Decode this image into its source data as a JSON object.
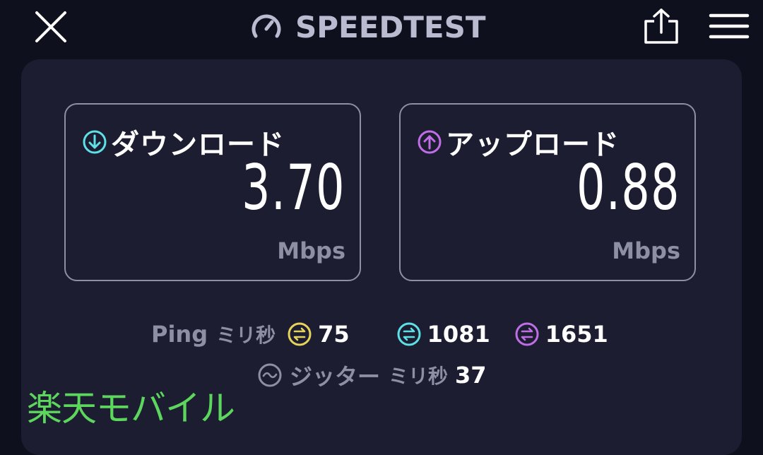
{
  "header": {
    "app_title": "SPEEDTEST",
    "close_icon": "close-icon",
    "share_icon": "share-icon",
    "menu_icon": "menu-icon"
  },
  "download": {
    "label": "ダウンロード",
    "value": "3.70",
    "unit": "Mbps",
    "icon": "download-arrow-icon",
    "accent_color": "#5de0e6"
  },
  "upload": {
    "label": "アップロード",
    "value": "0.88",
    "unit": "Mbps",
    "icon": "upload-arrow-icon",
    "accent_color": "#c06ee6"
  },
  "ping": {
    "label": "Ping",
    "unit_label": "ミリ秒",
    "idle": {
      "value": "75",
      "color": "#e8d35a"
    },
    "download": {
      "value": "1081",
      "color": "#5de0e6"
    },
    "upload": {
      "value": "1651",
      "color": "#c06ee6"
    }
  },
  "jitter": {
    "label": "ジッター",
    "unit_label": "ミリ秒",
    "value": "37"
  },
  "overlay": {
    "text": "楽天モバイル",
    "color": "#5cd65c"
  }
}
